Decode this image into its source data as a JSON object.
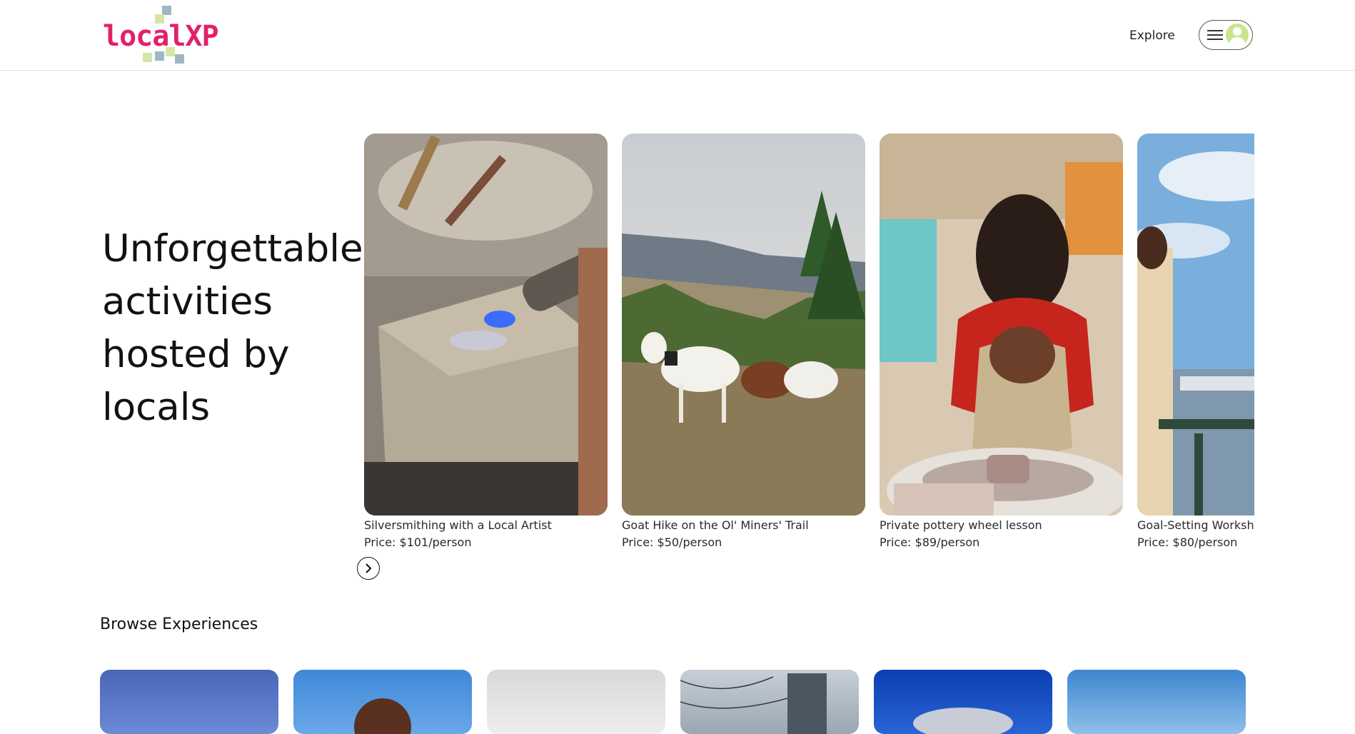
{
  "header": {
    "logo_text": "localXP",
    "nav_explore": "Explore"
  },
  "hero": {
    "title": "Unforgettable activities hosted by locals"
  },
  "carousel": {
    "cards": [
      {
        "title": "Silversmithing with a Local Artist",
        "price": "Price: $101/person"
      },
      {
        "title": "Goat Hike on the Ol' Miners' Trail",
        "price": "Price: $50/person"
      },
      {
        "title": "Private pottery wheel lesson",
        "price": "Price: $89/person"
      },
      {
        "title": "Goal-Setting Workshop",
        "price": "Price: $80/person"
      }
    ]
  },
  "browse": {
    "title": "Browse Experiences"
  },
  "colors": {
    "brand_pink": "#e2206a",
    "header_border": "#dfe6b8",
    "avatar_green": "#c9e58c"
  }
}
